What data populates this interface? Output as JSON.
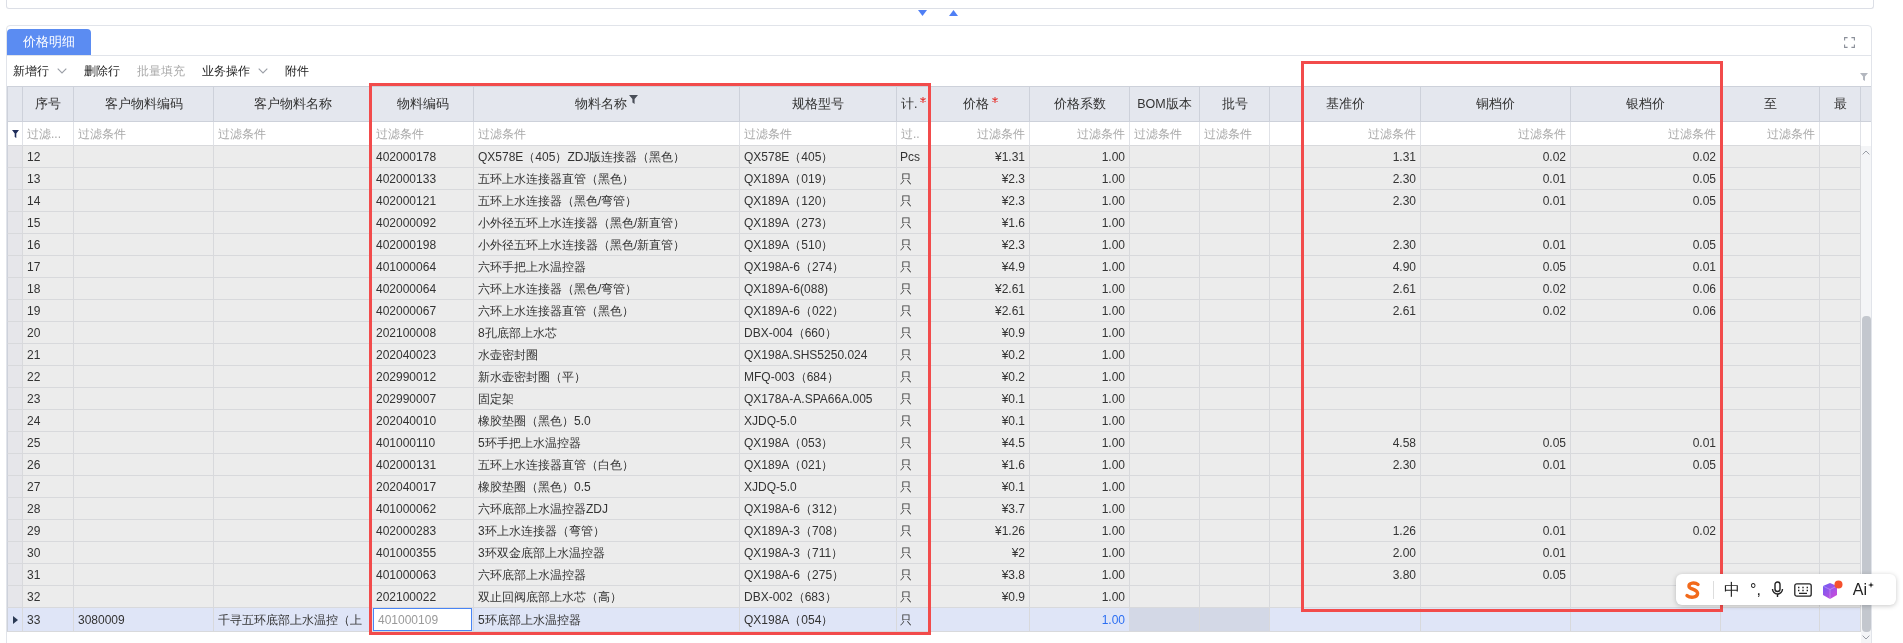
{
  "tabs": [
    {
      "label": "价格明细",
      "selected": true
    }
  ],
  "toolbar": [
    {
      "label": "新增行",
      "dropdown": true,
      "disabled": false
    },
    {
      "label": "删除行",
      "dropdown": false,
      "disabled": false
    },
    {
      "label": "批量填充",
      "dropdown": false,
      "disabled": true
    },
    {
      "label": "业务操作",
      "dropdown": true,
      "disabled": false
    },
    {
      "label": "附件",
      "dropdown": false,
      "disabled": false
    }
  ],
  "table": {
    "columns": [
      {
        "label": "序号",
        "required": false,
        "filter_active": false,
        "readonly": false,
        "filter_placeholder": "过滤..."
      },
      {
        "label": "客户物料编码",
        "required": false,
        "filter_active": false,
        "readonly": false,
        "filter_placeholder": "过滤条件"
      },
      {
        "label": "客户物料名称",
        "required": false,
        "filter_active": false,
        "readonly": false,
        "filter_placeholder": "过滤条件"
      },
      {
        "label": "物料编码",
        "required": false,
        "filter_active": false,
        "readonly": false,
        "filter_placeholder": "过滤条件"
      },
      {
        "label": "物料名称",
        "required": false,
        "filter_active": true,
        "readonly": false,
        "filter_placeholder": "过滤条件"
      },
      {
        "label": "规格型号",
        "required": false,
        "filter_active": false,
        "readonly": false,
        "filter_placeholder": "过滤条件"
      },
      {
        "label": "计.",
        "required": true,
        "filter_active": false,
        "readonly": false,
        "filter_placeholder": "过.."
      },
      {
        "label": "价格",
        "required": true,
        "filter_active": false,
        "readonly": false,
        "filter_placeholder": "过滤条件"
      },
      {
        "label": "价格系数",
        "required": false,
        "filter_active": false,
        "readonly": false,
        "filter_placeholder": "过滤条件"
      },
      {
        "label": "BOM版本",
        "required": false,
        "filter_active": false,
        "readonly": true,
        "filter_placeholder": "过滤条件"
      },
      {
        "label": "批号",
        "required": false,
        "filter_active": false,
        "readonly": true,
        "filter_placeholder": "过滤条件"
      },
      {
        "label": "基准价",
        "required": false,
        "filter_active": false,
        "readonly": false,
        "filter_placeholder": "过滤条件"
      },
      {
        "label": "铜档价",
        "required": false,
        "filter_active": false,
        "readonly": false,
        "filter_placeholder": "过滤条件"
      },
      {
        "label": "银档价",
        "required": false,
        "filter_active": false,
        "readonly": false,
        "filter_placeholder": "过滤条件"
      },
      {
        "label": "至",
        "required": false,
        "filter_active": false,
        "readonly": false,
        "filter_placeholder": "过滤条件"
      },
      {
        "label": "最",
        "required": false,
        "filter_active": false,
        "readonly": false
      }
    ],
    "rows": [
      {
        "selected": false,
        "seq": "12",
        "material_code": "402000178",
        "material_name": "QX578E（405）ZDJ版连接器（黑色）",
        "spec": "QX578E（405）",
        "unit": "Pcs",
        "price": "¥1.31",
        "price_factor": "1.00",
        "base_price": "1.31",
        "copper_price": "0.02",
        "silver_price": "0.02"
      },
      {
        "selected": false,
        "seq": "13",
        "material_code": "402000133",
        "material_name": "五环上水连接器直管（黑色）",
        "spec": "QX189A（019）",
        "unit": "只",
        "price": "¥2.3",
        "price_factor": "1.00",
        "base_price": "2.30",
        "copper_price": "0.01",
        "silver_price": "0.05"
      },
      {
        "selected": false,
        "seq": "14",
        "material_code": "402000121",
        "material_name": "五环上水连接器（黑色/弯管）",
        "spec": "QX189A（120）",
        "unit": "只",
        "price": "¥2.3",
        "price_factor": "1.00",
        "base_price": "2.30",
        "copper_price": "0.01",
        "silver_price": "0.05"
      },
      {
        "selected": false,
        "seq": "15",
        "material_code": "402000092",
        "material_name": "小外径五环上水连接器（黑色/新直管）",
        "spec": "QX189A（273）",
        "unit": "只",
        "price": "¥1.6",
        "price_factor": "1.00"
      },
      {
        "selected": false,
        "seq": "16",
        "material_code": "402000198",
        "material_name": "小外径五环上水连接器（黑色/新直管）",
        "spec": "QX189A（510）",
        "unit": "只",
        "price": "¥2.3",
        "price_factor": "1.00",
        "base_price": "2.30",
        "copper_price": "0.01",
        "silver_price": "0.05"
      },
      {
        "selected": false,
        "seq": "17",
        "material_code": "401000064",
        "material_name": "六环手把上水温控器",
        "spec": "QX198A-6（274）",
        "unit": "只",
        "price": "¥4.9",
        "price_factor": "1.00",
        "base_price": "4.90",
        "copper_price": "0.05",
        "silver_price": "0.01"
      },
      {
        "selected": false,
        "seq": "18",
        "material_code": "402000064",
        "material_name": "六环上水连接器（黑色/弯管）",
        "spec": "QX189A-6(088)",
        "unit": "只",
        "price": "¥2.61",
        "price_factor": "1.00",
        "base_price": "2.61",
        "copper_price": "0.02",
        "silver_price": "0.06"
      },
      {
        "selected": false,
        "seq": "19",
        "material_code": "402000067",
        "material_name": "六环上水连接器直管（黑色）",
        "spec": "QX189A-6（022）",
        "unit": "只",
        "price": "¥2.61",
        "price_factor": "1.00",
        "base_price": "2.61",
        "copper_price": "0.02",
        "silver_price": "0.06"
      },
      {
        "selected": false,
        "seq": "20",
        "material_code": "202100008",
        "material_name": "8孔底部上水芯",
        "spec": "DBX-004（660）",
        "unit": "只",
        "price": "¥0.9",
        "price_factor": "1.00"
      },
      {
        "selected": false,
        "seq": "21",
        "material_code": "202040023",
        "material_name": "水壶密封圈",
        "spec": "QX198A.SHS5250.024",
        "unit": "只",
        "price": "¥0.2",
        "price_factor": "1.00"
      },
      {
        "selected": false,
        "seq": "22",
        "material_code": "202990012",
        "material_name": "新水壶密封圈（平）",
        "spec": "MFQ-003（684）",
        "unit": "只",
        "price": "¥0.2",
        "price_factor": "1.00"
      },
      {
        "selected": false,
        "seq": "23",
        "material_code": "202990007",
        "material_name": "固定架",
        "spec": "QX178A-A.SPA66A.005",
        "unit": "只",
        "price": "¥0.1",
        "price_factor": "1.00"
      },
      {
        "selected": false,
        "seq": "24",
        "material_code": "202040010",
        "material_name": "橡胶垫圈（黑色）5.0",
        "spec": "XJDQ-5.0",
        "unit": "只",
        "price": "¥0.1",
        "price_factor": "1.00"
      },
      {
        "selected": false,
        "seq": "25",
        "material_code": "401000110",
        "material_name": "5环手把上水温控器",
        "spec": "QX198A（053）",
        "unit": "只",
        "price": "¥4.5",
        "price_factor": "1.00",
        "base_price": "4.58",
        "copper_price": "0.05",
        "silver_price": "0.01"
      },
      {
        "selected": false,
        "seq": "26",
        "material_code": "402000131",
        "material_name": "五环上水连接器直管（白色）",
        "spec": "QX189A（021）",
        "unit": "只",
        "price": "¥1.6",
        "price_factor": "1.00",
        "base_price": "2.30",
        "copper_price": "0.01",
        "silver_price": "0.05"
      },
      {
        "selected": false,
        "seq": "27",
        "material_code": "202040017",
        "material_name": "橡胶垫圈（黑色）0.5",
        "spec": "XJDQ-5.0",
        "unit": "只",
        "price": "¥0.1",
        "price_factor": "1.00"
      },
      {
        "selected": false,
        "seq": "28",
        "material_code": "401000062",
        "material_name": "六环底部上水温控器ZDJ",
        "spec": "QX198A-6（312）",
        "unit": "只",
        "price": "¥3.7",
        "price_factor": "1.00"
      },
      {
        "selected": false,
        "seq": "29",
        "material_code": "402000283",
        "material_name": "3环上水连接器（弯管）",
        "spec": "QX189A-3（708）",
        "unit": "只",
        "price": "¥1.26",
        "price_factor": "1.00",
        "base_price": "1.26",
        "copper_price": "0.01",
        "silver_price": "0.02"
      },
      {
        "selected": false,
        "seq": "30",
        "material_code": "401000355",
        "material_name": "3环双金底部上水温控器",
        "spec": "QX198A-3（711）",
        "unit": "只",
        "price": "¥2",
        "price_factor": "1.00",
        "base_price": "2.00",
        "copper_price": "0.01"
      },
      {
        "selected": false,
        "seq": "31",
        "material_code": "401000063",
        "material_name": "六环底部上水温控器",
        "spec": "QX198A-6（275）",
        "unit": "只",
        "price": "¥3.8",
        "price_factor": "1.00",
        "base_price": "3.80",
        "copper_price": "0.05"
      },
      {
        "selected": false,
        "seq": "32",
        "material_code": "202100022",
        "material_name": "双止回阀底部上水芯（高）",
        "spec": "DBX-002（683）",
        "unit": "只",
        "price": "¥0.9",
        "price_factor": "1.00"
      },
      {
        "selected": true,
        "seq": "33",
        "customer_code": "3080009",
        "customer_name": "千寻五环底部上水温控（上",
        "material_code": {
          "value": "401000109",
          "kind": "input"
        },
        "material_name": "5环底部上水温控器",
        "spec": "QX198A（054）",
        "unit": "只",
        "price_factor": {
          "value": "1.00",
          "kind": "edited"
        }
      }
    ]
  },
  "annotations": [
    {
      "kind": "rectangle",
      "color": "#f24b4b"
    },
    {
      "kind": "rectangle",
      "color": "#f24b4b"
    }
  ],
  "ime_toolbar": {
    "language": "中",
    "punctuation": "°,",
    "ai_label": "Ai"
  }
}
